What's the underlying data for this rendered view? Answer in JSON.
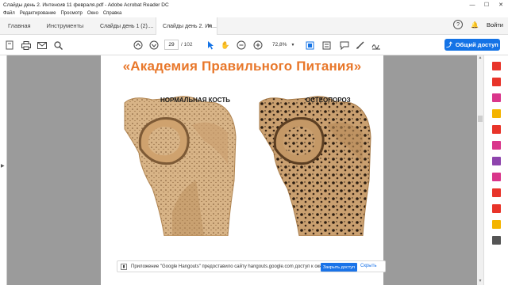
{
  "window": {
    "title": "Слайды день 2. Интенсив 11 февраля.pdf - Adobe Acrobat Reader DC",
    "minimize_glyph": "—",
    "maximize_glyph": "☐",
    "close_glyph": "✕"
  },
  "menu": {
    "items": [
      "Файл",
      "Редактирование",
      "Просмотр",
      "Окно",
      "Справка"
    ]
  },
  "tabs": {
    "home": "Главная",
    "tools": "Инструменты",
    "docs": [
      {
        "label": "Слайды день 1 (2)...."
      },
      {
        "label": "Слайды день 2. Ин..."
      }
    ],
    "help": "?",
    "signin": "Войти"
  },
  "toolbar": {
    "page_current": "29",
    "page_total": "/ 102",
    "zoom": "72,8%",
    "share_label": "Общий доступ"
  },
  "slide": {
    "title": "«Академия Правильного Питания»",
    "left_label": "НОРМАЛЬНАЯ КОСТЬ",
    "right_label": "ОСТЕОПОРОЗ"
  },
  "notice": {
    "text": "Приложение \"Google Hangouts\" предоставило сайту hangouts.google.com доступ к окну.",
    "allow": "Закрыть доступ",
    "hide": "Скрыть"
  },
  "colors": {
    "accent": "#1473e6",
    "title_orange": "#e8772a",
    "canvas_gray": "#9b9b9b"
  }
}
